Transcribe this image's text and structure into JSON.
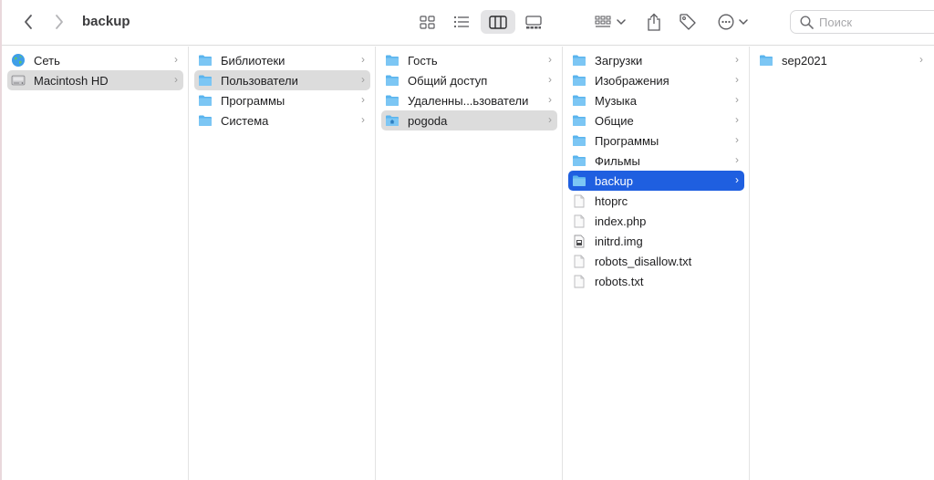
{
  "window": {
    "title": "backup"
  },
  "toolbar": {
    "back_icon": "chevron-left-icon",
    "forward_icon": "chevron-right-icon",
    "view_modes": [
      "icon-view",
      "list-view",
      "column-view",
      "gallery-view"
    ],
    "active_view": "column-view",
    "group_icon": "group-icon",
    "share_icon": "share-icon",
    "tag_icon": "tag-icon",
    "more_icon": "ellipsis-circle-icon",
    "search": {
      "placeholder": "Поиск"
    }
  },
  "colors": {
    "selection_active": "#1f5fe0",
    "selection_inactive": "#dcdcdc",
    "folder": "#5ab4ee"
  },
  "columns": [
    {
      "items": [
        {
          "label": "Сеть",
          "icon": "network-globe-icon",
          "state": "none"
        },
        {
          "label": "Macintosh HD",
          "icon": "hard-drive-icon",
          "state": "selected"
        }
      ]
    },
    {
      "items": [
        {
          "label": "Библиотеки",
          "icon": "folder-icon",
          "state": "none"
        },
        {
          "label": "Пользователи",
          "icon": "folder-icon",
          "state": "selected"
        },
        {
          "label": "Программы",
          "icon": "folder-icon",
          "state": "none"
        },
        {
          "label": "Система",
          "icon": "folder-icon",
          "state": "none"
        }
      ]
    },
    {
      "items": [
        {
          "label": "Гость",
          "icon": "folder-icon",
          "state": "none"
        },
        {
          "label": "Общий доступ",
          "icon": "folder-icon",
          "state": "none"
        },
        {
          "label": "Удаленны...ьзователи",
          "icon": "folder-icon",
          "state": "none"
        },
        {
          "label": "pogoda",
          "icon": "home-folder-icon",
          "state": "selected"
        }
      ]
    },
    {
      "items": [
        {
          "label": "Загрузки",
          "icon": "folder-icon",
          "state": "none"
        },
        {
          "label": "Изображения",
          "icon": "folder-icon",
          "state": "none"
        },
        {
          "label": "Музыка",
          "icon": "folder-icon",
          "state": "none"
        },
        {
          "label": "Общие",
          "icon": "folder-icon",
          "state": "none"
        },
        {
          "label": "Программы",
          "icon": "folder-icon",
          "state": "none"
        },
        {
          "label": "Фильмы",
          "icon": "folder-icon",
          "state": "none"
        },
        {
          "label": "backup",
          "icon": "folder-icon",
          "state": "active"
        },
        {
          "label": "htoprc",
          "icon": "document-icon",
          "state": "none"
        },
        {
          "label": "index.php",
          "icon": "document-icon",
          "state": "none"
        },
        {
          "label": "initrd.img",
          "icon": "image-document-icon",
          "state": "none"
        },
        {
          "label": "robots_disallow.txt",
          "icon": "document-icon",
          "state": "none"
        },
        {
          "label": "robots.txt",
          "icon": "document-icon",
          "state": "none"
        }
      ]
    },
    {
      "items": [
        {
          "label": "sep2021",
          "icon": "folder-icon",
          "state": "none"
        }
      ]
    }
  ]
}
